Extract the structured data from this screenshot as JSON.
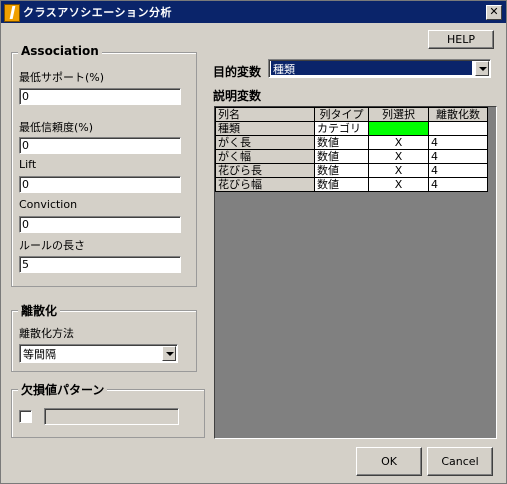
{
  "window": {
    "title": "クラスアソシエーション分析",
    "close_glyph": "✕"
  },
  "association": {
    "legend": "Association",
    "min_support_label": "最低サポート(%)",
    "min_support_value": "0",
    "min_confidence_label": "最低信頼度(%)",
    "min_confidence_value": "0",
    "lift_label": "Lift",
    "lift_value": "0",
    "conviction_label": "Conviction",
    "conviction_value": "0",
    "rule_length_label": "ルールの長さ",
    "rule_length_value": "5"
  },
  "discretization": {
    "legend": "離散化",
    "method_label": "離散化方法",
    "method_value": "等間隔"
  },
  "missing": {
    "legend": "欠損値パターン",
    "checked": false,
    "value": ""
  },
  "help_label": "HELP",
  "target": {
    "label": "目的変数",
    "value": "種類",
    "highlight": "#0a246a"
  },
  "explanatory": {
    "label": "説明変数",
    "headers": [
      "列名",
      "列タイプ",
      "列選択",
      "離散化数"
    ],
    "rows": [
      {
        "name": "種類",
        "type": "カテゴリ",
        "select": "",
        "bins": "",
        "selected_color": "#00ff00"
      },
      {
        "name": "がく長",
        "type": "数値",
        "select": "X",
        "bins": "4"
      },
      {
        "name": "がく幅",
        "type": "数値",
        "select": "X",
        "bins": "4"
      },
      {
        "name": "花びら長",
        "type": "数値",
        "select": "X",
        "bins": "4"
      },
      {
        "name": "花びら幅",
        "type": "数値",
        "select": "X",
        "bins": "4"
      }
    ]
  },
  "ok_label": "OK",
  "cancel_label": "Cancel"
}
